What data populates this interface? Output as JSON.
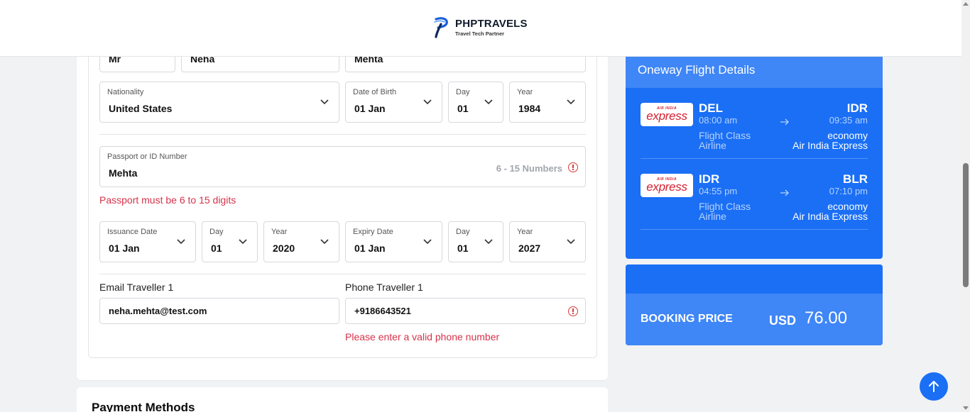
{
  "header": {
    "brand_name": "PHPTRAVELS",
    "brand_tagline": "Travel Tech Partner"
  },
  "traveller": {
    "title_value": "Mr",
    "first_name": "Neha",
    "last_name": "Mehta",
    "nationality": {
      "label": "Nationality",
      "value": "United States"
    },
    "dob": {
      "label": "Date of Birth",
      "value": "01 Jan",
      "day_label": "Day",
      "day": "01",
      "year_label": "Year",
      "year": "1984"
    },
    "passport": {
      "label": "Passport or ID Number",
      "value": "Mehta",
      "hint": "6 - 15 Numbers",
      "error": "Passport must be 6 to 15 digits"
    },
    "issuance": {
      "label": "Issuance Date",
      "value": "01 Jan",
      "day_label": "Day",
      "day": "01",
      "year_label": "Year",
      "year": "2020"
    },
    "expiry": {
      "label": "Expiry Date",
      "value": "01 Jan",
      "day_label": "Day",
      "day": "01",
      "year_label": "Year",
      "year": "2027"
    },
    "email": {
      "label": "Email Traveller 1",
      "value": "neha.mehta@test.com"
    },
    "phone": {
      "label": "Phone Traveller 1",
      "value": "+9186643521",
      "error": "Please enter a valid phone number"
    }
  },
  "payment": {
    "title": "Payment Methods"
  },
  "flight_details": {
    "title": "Oneway Flight Details",
    "segments": [
      {
        "airline_logo_small": "AIR INDIA",
        "airline_logo_big": "express",
        "from": "DEL",
        "from_time": "08:00 am",
        "to": "IDR",
        "to_time": "09:35 am",
        "class_label": "Flight Class",
        "class_value": "economy",
        "airline_label": "Airline",
        "airline_value": "Air India Express"
      },
      {
        "airline_logo_small": "AIR INDIA",
        "airline_logo_big": "express",
        "from": "IDR",
        "from_time": "04:55 pm",
        "to": "BLR",
        "to_time": "07:10 pm",
        "class_label": "Flight Class",
        "class_value": "economy",
        "airline_label": "Airline",
        "airline_value": "Air India Express"
      }
    ]
  },
  "booking": {
    "label": "BOOKING PRICE",
    "currency": "USD",
    "amount": "76.00"
  },
  "colors": {
    "primary": "#1a6ff5",
    "primary_light": "#3f86f6",
    "error": "#d6334a"
  },
  "icons": {
    "back_to_top": "arrow-up-icon",
    "dropdown": "chevron-down-icon",
    "error": "alert-circle-icon",
    "segment_arrow": "arrow-right-icon"
  }
}
